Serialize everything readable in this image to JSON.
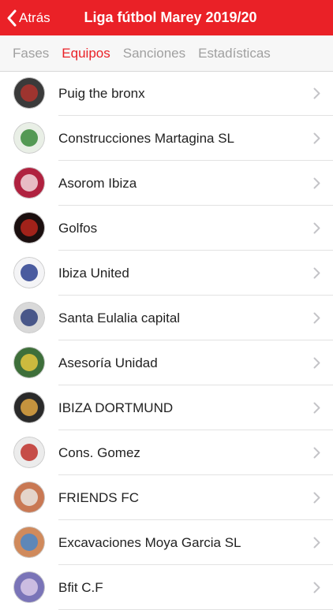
{
  "nav": {
    "back_icon": "chevron-left-icon",
    "back_label": "Atrás",
    "title": "Liga fútbol Marey 2019/20",
    "bar_color": "#ea2127"
  },
  "tabs": [
    {
      "label": "Fases",
      "active": false
    },
    {
      "label": "Equipos",
      "active": true
    },
    {
      "label": "Sanciones",
      "active": false
    },
    {
      "label": "Estadísticas",
      "active": false
    }
  ],
  "teams": [
    {
      "name": "Puig the bronx",
      "avatar_colors": [
        "#3a3a3a",
        "#b0342e"
      ]
    },
    {
      "name": "Construcciones Martagina SL",
      "avatar_colors": [
        "#e9efe6",
        "#3a8a3a"
      ]
    },
    {
      "name": "Asorom Ibiza",
      "avatar_colors": [
        "#b0213f",
        "#f2d6dc"
      ]
    },
    {
      "name": "Golfos",
      "avatar_colors": [
        "#1b0f0f",
        "#b8261c"
      ]
    },
    {
      "name": "Ibiza United",
      "avatar_colors": [
        "#f4f4f6",
        "#2b3f8f"
      ]
    },
    {
      "name": "Santa Eulalia capital",
      "avatar_colors": [
        "#d9d9d9",
        "#2f3f7a"
      ]
    },
    {
      "name": "Asesoría Unidad",
      "avatar_colors": [
        "#3e6f3a",
        "#e5c840"
      ]
    },
    {
      "name": "IBIZA DORTMUND",
      "avatar_colors": [
        "#2a2a2a",
        "#e1a642"
      ]
    },
    {
      "name": "Cons. Gomez",
      "avatar_colors": [
        "#ececec",
        "#c0312c"
      ]
    },
    {
      "name": "FRIENDS FC",
      "avatar_colors": [
        "#c97853",
        "#e9e4df"
      ]
    },
    {
      "name": "Excavaciones Moya Garcia SL",
      "avatar_colors": [
        "#d08a5c",
        "#4a86c8"
      ]
    },
    {
      "name": "Bfit C.F",
      "avatar_colors": [
        "#7a74b8",
        "#d9c9e8"
      ]
    }
  ]
}
